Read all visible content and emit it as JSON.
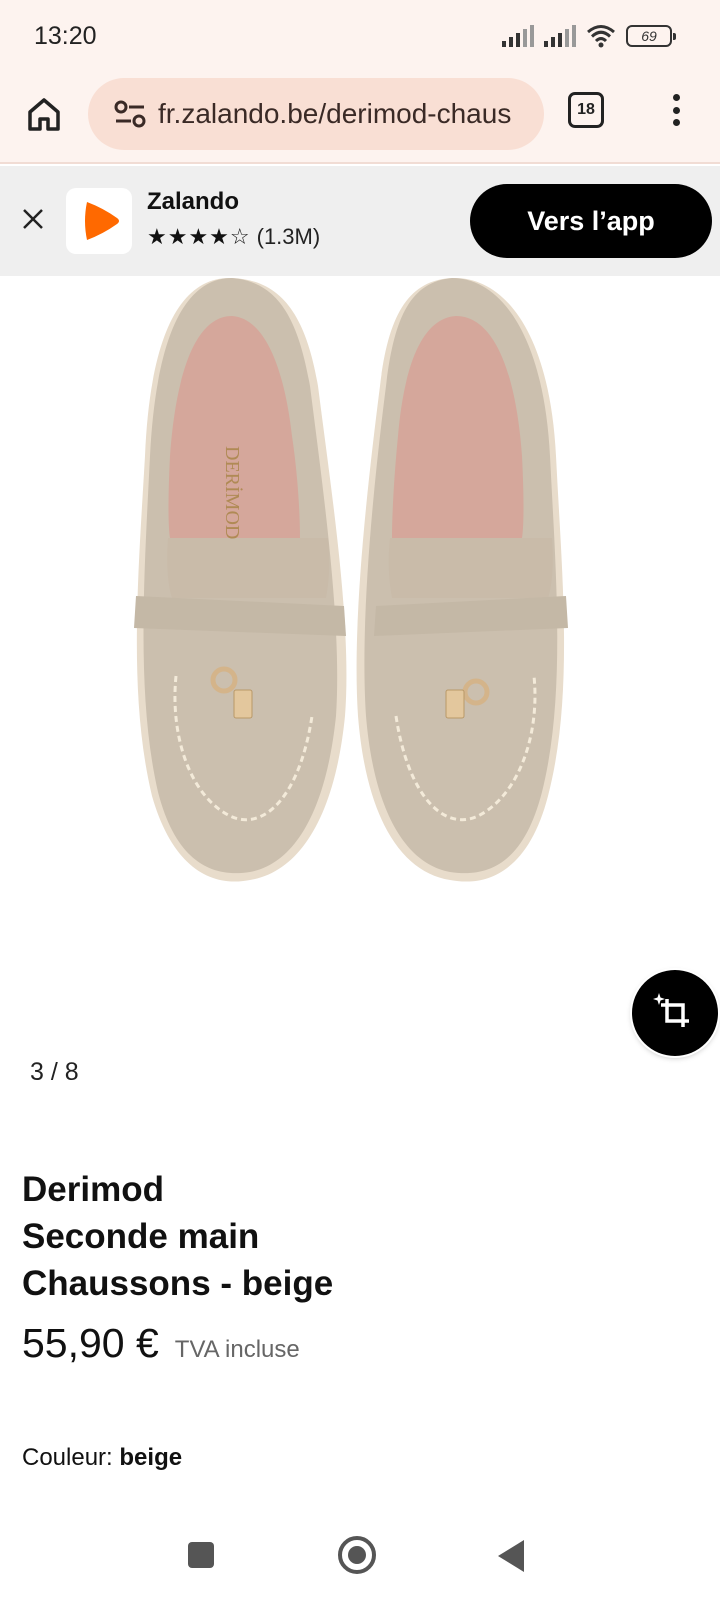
{
  "status_bar": {
    "time": "13:20",
    "battery": "69",
    "icons": [
      "signal-icon",
      "signal-icon",
      "wifi-icon",
      "battery-icon"
    ]
  },
  "browser": {
    "url": "fr.zalando.be/derimod-chaus",
    "tab_count": "18",
    "icons": [
      "home-icon",
      "tune-icon",
      "tabs-icon",
      "more-vert-icon"
    ]
  },
  "app_banner": {
    "app_name": "Zalando",
    "stars": "★★★★☆",
    "rating_count": "(1.3M)",
    "open_app_label": "Vers l’app",
    "accent_color": "#ff6900"
  },
  "gallery": {
    "counter": "3 / 8",
    "shoe_brand_print": "DERİMOD",
    "shoe_color": "#cbbfae"
  },
  "product": {
    "brand": "Derimod",
    "condition": "Seconde main",
    "name": "Chaussons - beige",
    "price": "55,90 €",
    "vat": "TVA incluse",
    "color_label": "Couleur:",
    "color_value": "beige"
  },
  "nav_bar": {
    "icons": [
      "recent-apps-icon",
      "home-circle-icon",
      "back-icon"
    ]
  }
}
